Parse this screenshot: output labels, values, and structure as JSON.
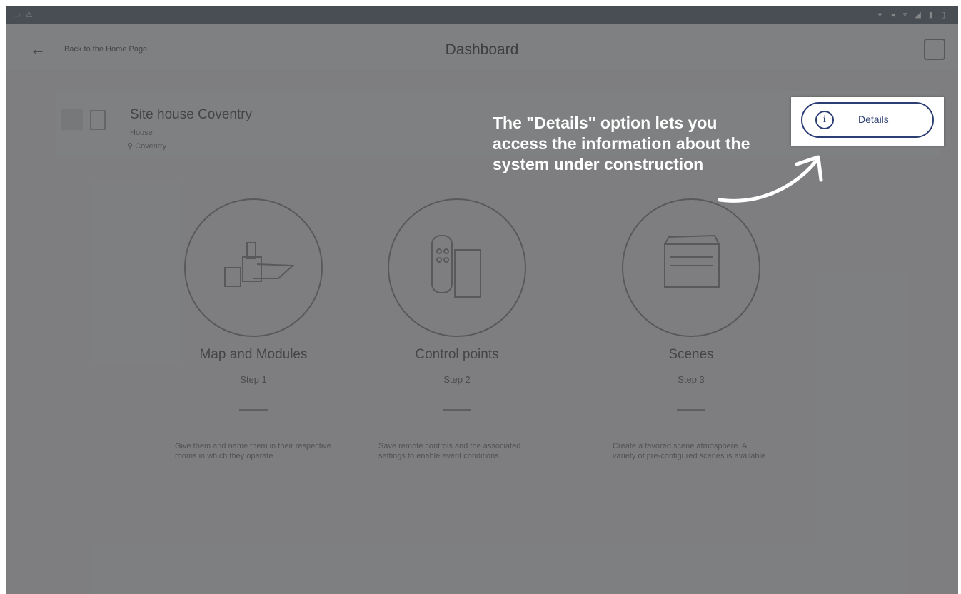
{
  "statusbar": {
    "left": "▭ ⚠",
    "right": "✦ ◂ ▿ ◢ ▮ ▯"
  },
  "topbar": {
    "back_label": "Back to the Home Page",
    "title": "Dashboard",
    "back_icon": "arrow-left-icon",
    "user_icon": "profile-icon"
  },
  "site": {
    "name": "Site house Coventry",
    "type": "House",
    "location": "Coventry"
  },
  "steps": [
    {
      "title": "Map and Modules",
      "num": "Step 1",
      "desc": "Give them and name them in their respective rooms in which they operate",
      "icon": "modules-icon"
    },
    {
      "title": "Control points",
      "num": "Step 2",
      "desc": "Save remote controls and the associated settings to enable event conditions",
      "icon": "remote-control-icon"
    },
    {
      "title": "Scenes",
      "num": "Step 3",
      "desc": "Create a favored scene atmosphere. A variety of pre-configured scenes is available",
      "icon": "scene-icon"
    }
  ],
  "callout": {
    "text": "The \"Details\" option lets you access the information about the system under construction"
  },
  "details_button": {
    "label": "Details",
    "icon": "info-icon"
  },
  "colors": {
    "accent": "#2c3e73",
    "overlay": "#3c3c3c"
  }
}
